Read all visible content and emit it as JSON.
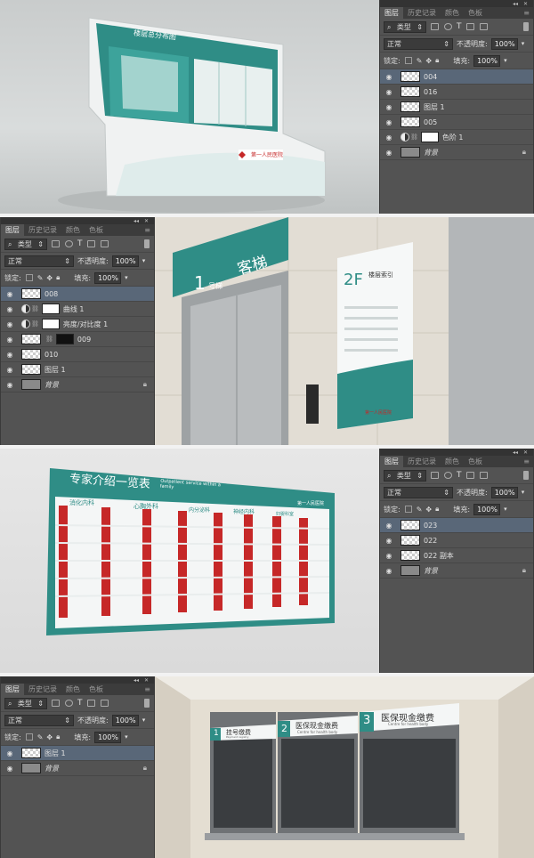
{
  "panel1": {
    "tabs": [
      "图层",
      "历史记录",
      "颜色",
      "色板"
    ],
    "filter": "类型",
    "blend_mode": "正常",
    "opacity_label": "不透明度:",
    "opacity_value": "100%",
    "lock_label": "锁定:",
    "fill_label": "填充:",
    "fill_value": "100%",
    "layers": [
      "004",
      "016",
      "图层 1",
      "005",
      "色阶 1",
      "背景"
    ]
  },
  "panel2": {
    "tabs": [
      "图层",
      "历史记录",
      "颜色",
      "色板"
    ],
    "filter": "类型",
    "blend_mode": "正常",
    "opacity_label": "不透明度:",
    "opacity_value": "100%",
    "lock_label": "锁定:",
    "fill_label": "填充:",
    "fill_value": "100%",
    "layers": [
      "008",
      "曲线 1",
      "亮度/对比度 1",
      "009",
      "010",
      "图层 1",
      "背景"
    ]
  },
  "panel3": {
    "tabs": [
      "图层",
      "历史记录",
      "颜色",
      "色板"
    ],
    "filter": "类型",
    "blend_mode": "正常",
    "opacity_label": "不透明度:",
    "opacity_value": "100%",
    "lock_label": "锁定:",
    "fill_label": "填充:",
    "fill_value": "100%",
    "layers": [
      "023",
      "022",
      "022 副本",
      "背景"
    ]
  },
  "panel4": {
    "tabs": [
      "图层",
      "历史记录",
      "颜色",
      "色板"
    ],
    "filter": "类型",
    "blend_mode": "正常",
    "opacity_label": "不透明度:",
    "opacity_value": "100%",
    "lock_label": "锁定:",
    "fill_label": "填充:",
    "fill_value": "100%",
    "layers": [
      "图层 1",
      "背景"
    ]
  },
  "scene1": {
    "sign_title": "楼层总分布图",
    "hospital": "第一人民医院"
  },
  "scene2": {
    "floor_number": "1",
    "floor_label": "号梯",
    "elevator_cn": "客梯",
    "floor_2f": "2F",
    "floor_guide": "楼层索引",
    "hospital": "第一人民医院"
  },
  "scene3": {
    "board_title": "专家介绍一览表",
    "board_sub_en": "Outpatient service within a family",
    "departments": [
      "消化内科",
      "心胸外科",
      "内分泌科",
      "神经内科",
      "妇婴科室"
    ],
    "hospital": "第一人民医院"
  },
  "scene4": {
    "windows": [
      {
        "num": "1",
        "cn": "挂号缴费",
        "en": "Payment registry"
      },
      {
        "num": "2",
        "cn": "医保现金缴费",
        "en": "Centre for health body"
      },
      {
        "num": "3",
        "cn": "医保现金缴费",
        "en": "Centre for health body"
      }
    ]
  },
  "colors": {
    "teal": "#2f8d86",
    "panel_bg": "#535353",
    "selected_layer": "#596778"
  }
}
